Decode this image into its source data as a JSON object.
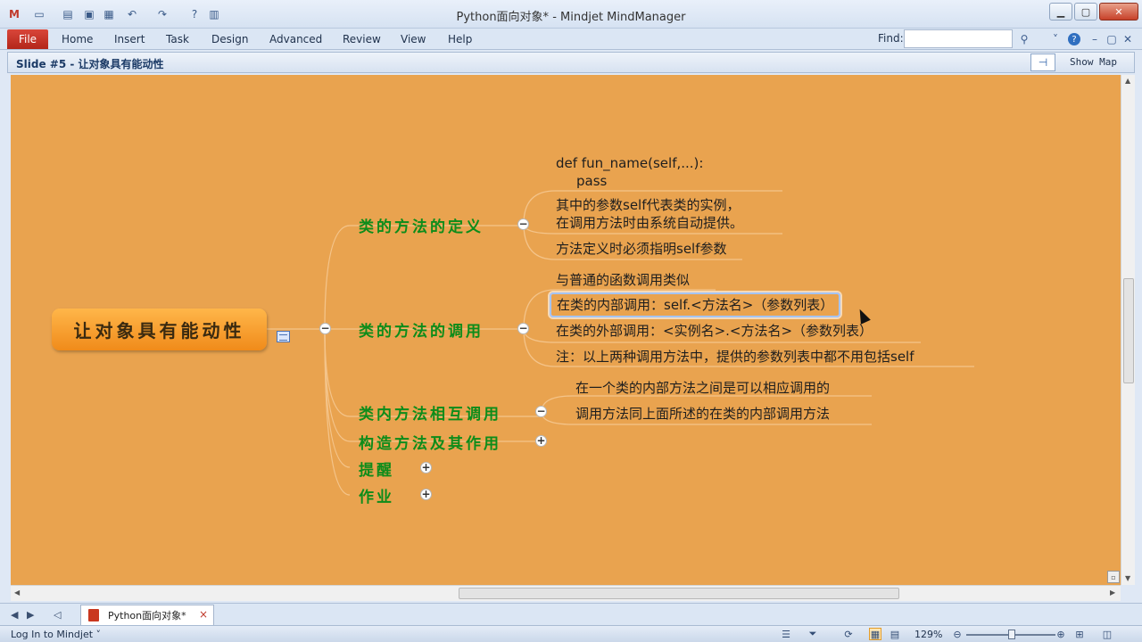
{
  "window": {
    "title": "Python面向对象* - Mindjet MindManager"
  },
  "ribbon": {
    "file": "File",
    "tabs": [
      "Home",
      "Insert",
      "Task",
      "Design",
      "Advanced",
      "Review",
      "View",
      "Help"
    ],
    "find_label": "Find:",
    "find_value": ""
  },
  "slide": {
    "title": "Slide #5 - 让对象具有能动性",
    "show_map": "Show Map"
  },
  "map": {
    "central": "让对象具有能动性",
    "topics": [
      {
        "label": "类的方法的定义",
        "subtopics": [
          "def fun_name(self,...):",
          "pass",
          "其中的参数self代表类的实例，",
          "在调用方法时由系统自动提供。",
          "方法定义时必须指明self参数"
        ]
      },
      {
        "label": "类的方法的调用",
        "subtopics": [
          "与普通的函数调用类似",
          "在类的内部调用：self.<方法名>（参数列表）",
          "在类的外部调用：<实例名>.<方法名>（参数列表）",
          "注：以上两种调用方法中，提供的参数列表中都不用包括self"
        ]
      },
      {
        "label": "类内方法相互调用",
        "subtopics": [
          "在一个类的内部方法之间是可以相应调用的",
          "调用方法同上面所述的在类的内部调用方法"
        ]
      },
      {
        "label": "构造方法及其作用",
        "subtopics": []
      },
      {
        "label": "提醒",
        "subtopics": []
      },
      {
        "label": "作业",
        "subtopics": []
      }
    ],
    "collapse": "−",
    "expand": "+"
  },
  "document_tab": {
    "label": "Python面向对象*",
    "close": "×"
  },
  "statusbar": {
    "login": "Log In to Mindjet ˅",
    "zoom": "129%"
  },
  "colors": {
    "canvas": "#e9a34f",
    "central_topic": "#f39b25",
    "main_topic_text": "#0d8c1a"
  }
}
